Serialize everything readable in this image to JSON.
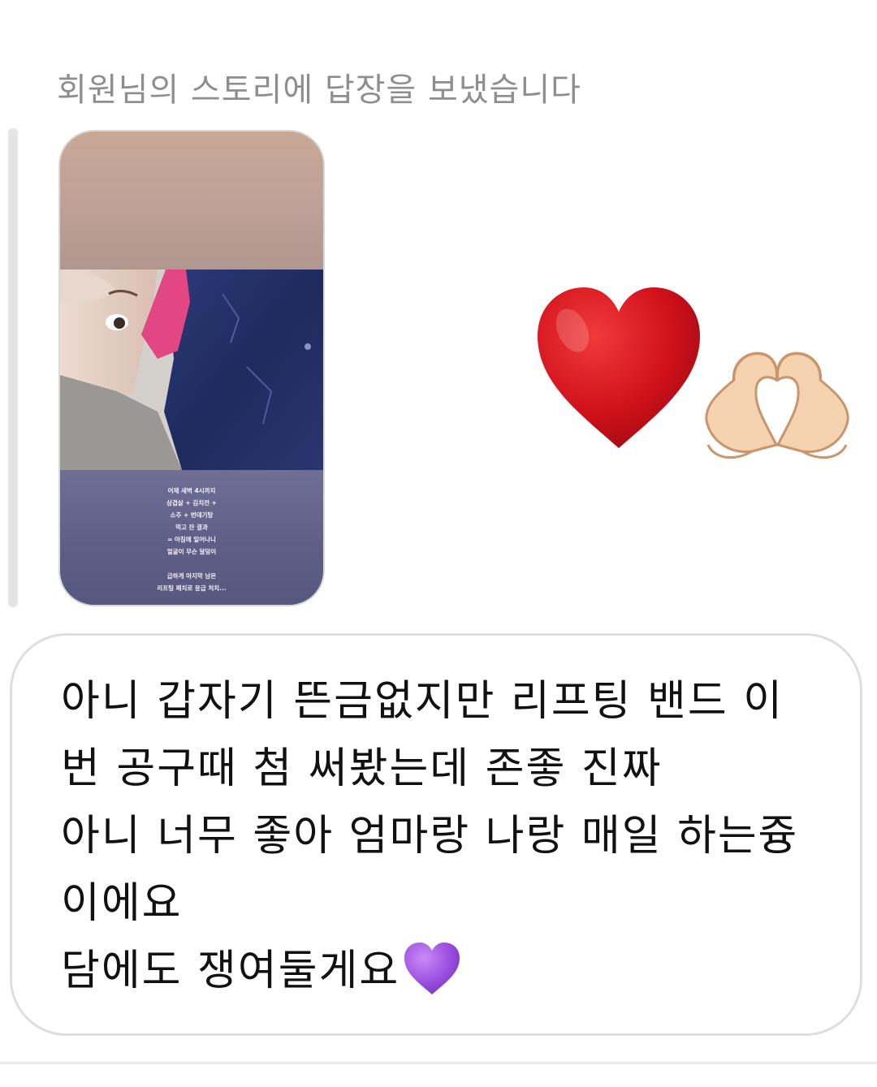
{
  "header": {
    "reply_label": "회원님의 스토리에 답장을 보냈습니다"
  },
  "story": {
    "caption_lines": [
      "어제 새벽 4시까지",
      "삼겹살 + 김치전 +",
      "소주 + 번데기탕",
      "먹고 잔 결과",
      "= 아침에 일어나니",
      "얼굴이 무슨 달덩이",
      "",
      "급하게 마지막 남은",
      "리프팅 패치로 응급 처치..."
    ]
  },
  "reactions": {
    "emoji_1": "red-heart-icon",
    "emoji_2": "heart-hands-icon"
  },
  "message": {
    "lines": [
      "아니 갑자기 뜬금없지만 리프팅 밴드 이",
      "번 공구때 첨 써봤는데 존좋 진짜",
      "아니 너무 좋아 엄마랑 나랑 매일 하는즁",
      "이에요",
      "담에도 쟁여둘게요"
    ],
    "trailing_emoji": "purple-heart-icon"
  },
  "colors": {
    "header_text": "#8e8e8e",
    "bubble_border": "#dedede",
    "message_text": "#111111",
    "heart_red": "#d0101a",
    "heart_purple": "#9b4fe0"
  }
}
